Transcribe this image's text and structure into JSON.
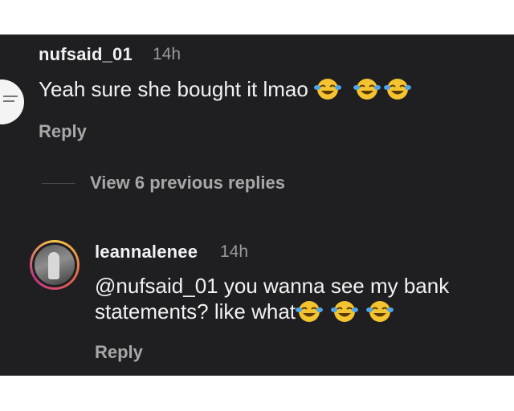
{
  "comment1": {
    "username": "nufsaid_01",
    "time": "14h",
    "text": "Yeah sure she bought it lmao",
    "emojis": [
      "😂",
      "😂",
      "😂"
    ],
    "reply_label": "Reply"
  },
  "view_previous": "View 6 previous replies",
  "comment2": {
    "username": "leannalenee",
    "time": "14h",
    "text_line1": "@nufsaid_01 you wanna see my bank",
    "text_line2": "statements? like what",
    "emojis": [
      "😂",
      "😂",
      "😂"
    ],
    "reply_label": "Reply"
  },
  "colors": {
    "background": "#1f1f21",
    "text": "#f2f2f2",
    "muted": "#a8a8a8",
    "story_ring": [
      "#f7c948",
      "#e0664d",
      "#c13584"
    ]
  }
}
